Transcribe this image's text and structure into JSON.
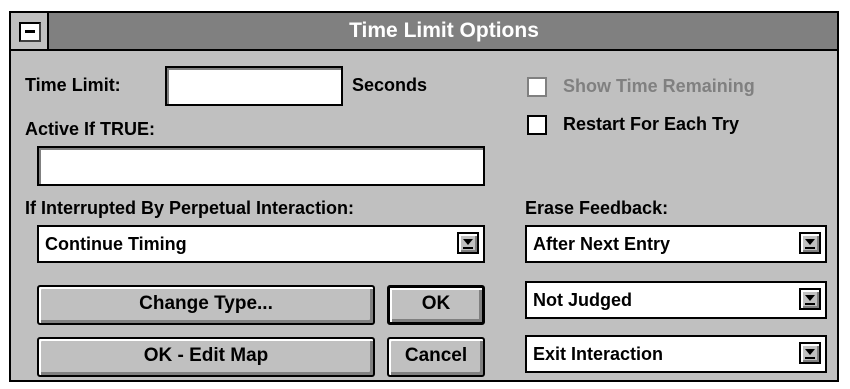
{
  "window": {
    "title": "Time Limit Options",
    "system_menu_icon": "minus-icon"
  },
  "time_limit": {
    "label": "Time Limit:",
    "value": "",
    "unit": "Seconds"
  },
  "active_if": {
    "label": "Active If TRUE:",
    "value": ""
  },
  "interrupted": {
    "label": "If Interrupted By Perpetual Interaction:",
    "selected": "Continue Timing"
  },
  "options": {
    "show_time_remaining": {
      "label": "Show Time Remaining",
      "checked": false,
      "enabled": false
    },
    "restart_each_try": {
      "label": "Restart For Each Try",
      "checked": false,
      "enabled": true
    }
  },
  "erase_feedback": {
    "label": "Erase Feedback:",
    "selected": "After Next Entry"
  },
  "judging": {
    "selected": "Not Judged"
  },
  "exit": {
    "selected": "Exit Interaction"
  },
  "buttons": {
    "change_type": "Change Type...",
    "ok": "OK",
    "ok_edit_map": "OK - Edit Map",
    "cancel": "Cancel"
  },
  "colors": {
    "face": "#c0c0c0",
    "titlebar": "#808080",
    "title_text": "#ffffff",
    "disabled_text": "#808080"
  }
}
